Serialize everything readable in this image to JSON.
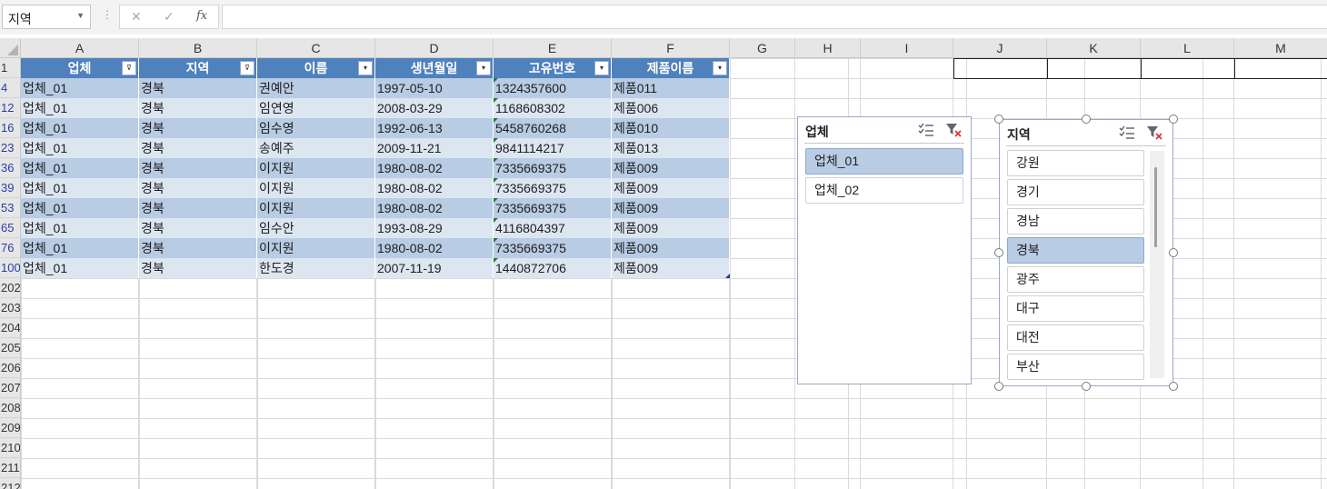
{
  "formula_bar": {
    "name_box": "지역",
    "cancel_glyph": "✕",
    "enter_glyph": "✓",
    "fx_glyph": "fx",
    "formula": ""
  },
  "columns": [
    "A",
    "B",
    "C",
    "D",
    "E",
    "F",
    "G",
    "H",
    "I",
    "J",
    "K",
    "L",
    "M"
  ],
  "row_numbers": [
    "1",
    "4",
    "12",
    "16",
    "23",
    "36",
    "39",
    "53",
    "65",
    "76",
    "100",
    "202",
    "203",
    "204",
    "205",
    "206",
    "207",
    "208",
    "209",
    "210",
    "211",
    "212"
  ],
  "table": {
    "headers": [
      "업체",
      "지역",
      "이름",
      "생년월일",
      "고유번호",
      "제품이름"
    ],
    "filter_glyph": "▾",
    "filtered_glyph": "⊽",
    "rows": [
      [
        "업체_01",
        "경북",
        "권예안",
        "1997-05-10",
        "1324357600",
        "제품011"
      ],
      [
        "업체_01",
        "경북",
        "임연영",
        "2008-03-29",
        "1168608302",
        "제품006"
      ],
      [
        "업체_01",
        "경북",
        "임수영",
        "1992-06-13",
        "5458760268",
        "제품010"
      ],
      [
        "업체_01",
        "경북",
        "송예주",
        "2009-11-21",
        "9841114217",
        "제품013"
      ],
      [
        "업체_01",
        "경북",
        "이지원",
        "1980-08-02",
        "7335669375",
        "제품009"
      ],
      [
        "업체_01",
        "경북",
        "이지원",
        "1980-08-02",
        "7335669375",
        "제품009"
      ],
      [
        "업체_01",
        "경북",
        "이지원",
        "1980-08-02",
        "7335669375",
        "제품009"
      ],
      [
        "업체_01",
        "경북",
        "임수안",
        "1993-08-29",
        "4116804397",
        "제품009"
      ],
      [
        "업체_01",
        "경북",
        "이지원",
        "1980-08-02",
        "7335669375",
        "제품009"
      ],
      [
        "업체_01",
        "경북",
        "한도경",
        "2007-11-19",
        "1440872706",
        "제품009"
      ]
    ]
  },
  "slicer_company": {
    "title": "업체",
    "items": [
      {
        "label": "업체_01",
        "selected": true
      },
      {
        "label": "업체_02",
        "selected": false
      }
    ]
  },
  "slicer_region": {
    "title": "지역",
    "items": [
      {
        "label": "강원",
        "selected": false
      },
      {
        "label": "경기",
        "selected": false
      },
      {
        "label": "경남",
        "selected": false
      },
      {
        "label": "경북",
        "selected": true
      },
      {
        "label": "광주",
        "selected": false
      },
      {
        "label": "대구",
        "selected": false
      },
      {
        "label": "대전",
        "selected": false
      },
      {
        "label": "부산",
        "selected": false
      }
    ]
  },
  "colors": {
    "table_header": "#4f81bd",
    "band_dark": "#b8cce4",
    "band_light": "#dce6f1",
    "slicer_selected": "#b8cce4",
    "clear_filter_icon": "#d9302c"
  }
}
